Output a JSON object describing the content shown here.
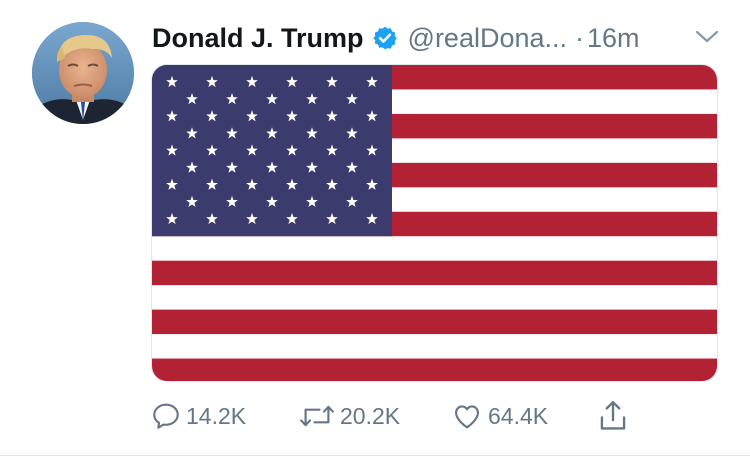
{
  "tweet": {
    "author": {
      "name": "Donald J. Trump",
      "handle": "@realDona...",
      "verified": true
    },
    "separator": "·",
    "time": "16m",
    "media": {
      "description_icon": "us-flag-image"
    },
    "actions": {
      "reply_count": "14.2K",
      "retweet_count": "20.2K",
      "like_count": "64.4K"
    }
  },
  "colors": {
    "verified_blue": "#1da1f2",
    "secondary_text": "#657786",
    "flag_red": "#b22234",
    "flag_blue": "#3c3b6e"
  }
}
